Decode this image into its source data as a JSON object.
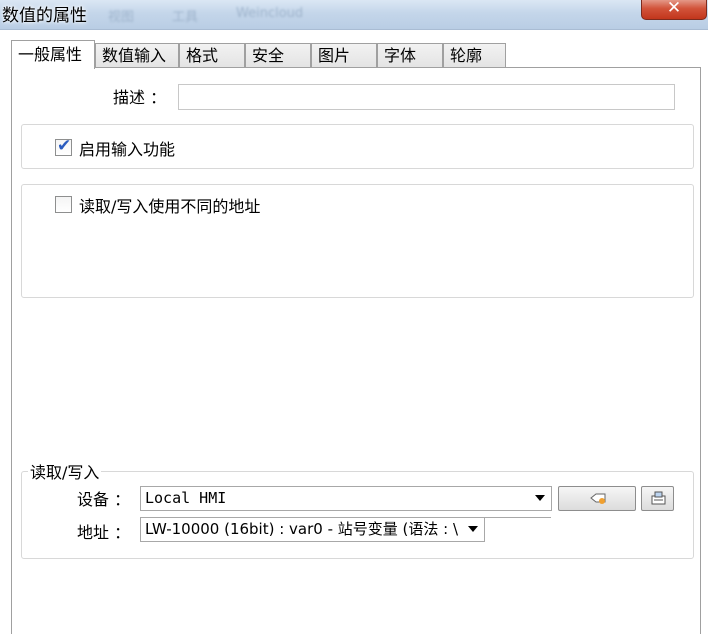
{
  "window": {
    "title": "数值的属性",
    "faded_menu": [
      "视图",
      "工具",
      "Weincloud"
    ],
    "close_glyph": "✕"
  },
  "tabs": [
    {
      "label": "一般属性",
      "active": true
    },
    {
      "label": "数值输入",
      "active": false
    },
    {
      "label": "格式",
      "active": false
    },
    {
      "label": "安全",
      "active": false
    },
    {
      "label": "图片",
      "active": false
    },
    {
      "label": "字体",
      "active": false
    },
    {
      "label": "轮廓",
      "active": false
    }
  ],
  "general": {
    "description_label": "描述 ：",
    "description_value": "",
    "enable_input_label": "启用输入功能",
    "enable_input_checked": true,
    "diff_address_label": "读取/写入使用不同的地址",
    "diff_address_checked": false
  },
  "readwrite": {
    "legend": "读取/写入",
    "device_label": "设备 ：",
    "device_value": "Local HMI",
    "address_label": "地址 ：",
    "address_value": "LW-10000 (16bit) : var0 - 站号变量 (语法 : \\"
  },
  "icons": {
    "settings_button_icon": "tag-settings-icon",
    "address_book_icon": "address-book-icon",
    "checkmark": "✔"
  }
}
